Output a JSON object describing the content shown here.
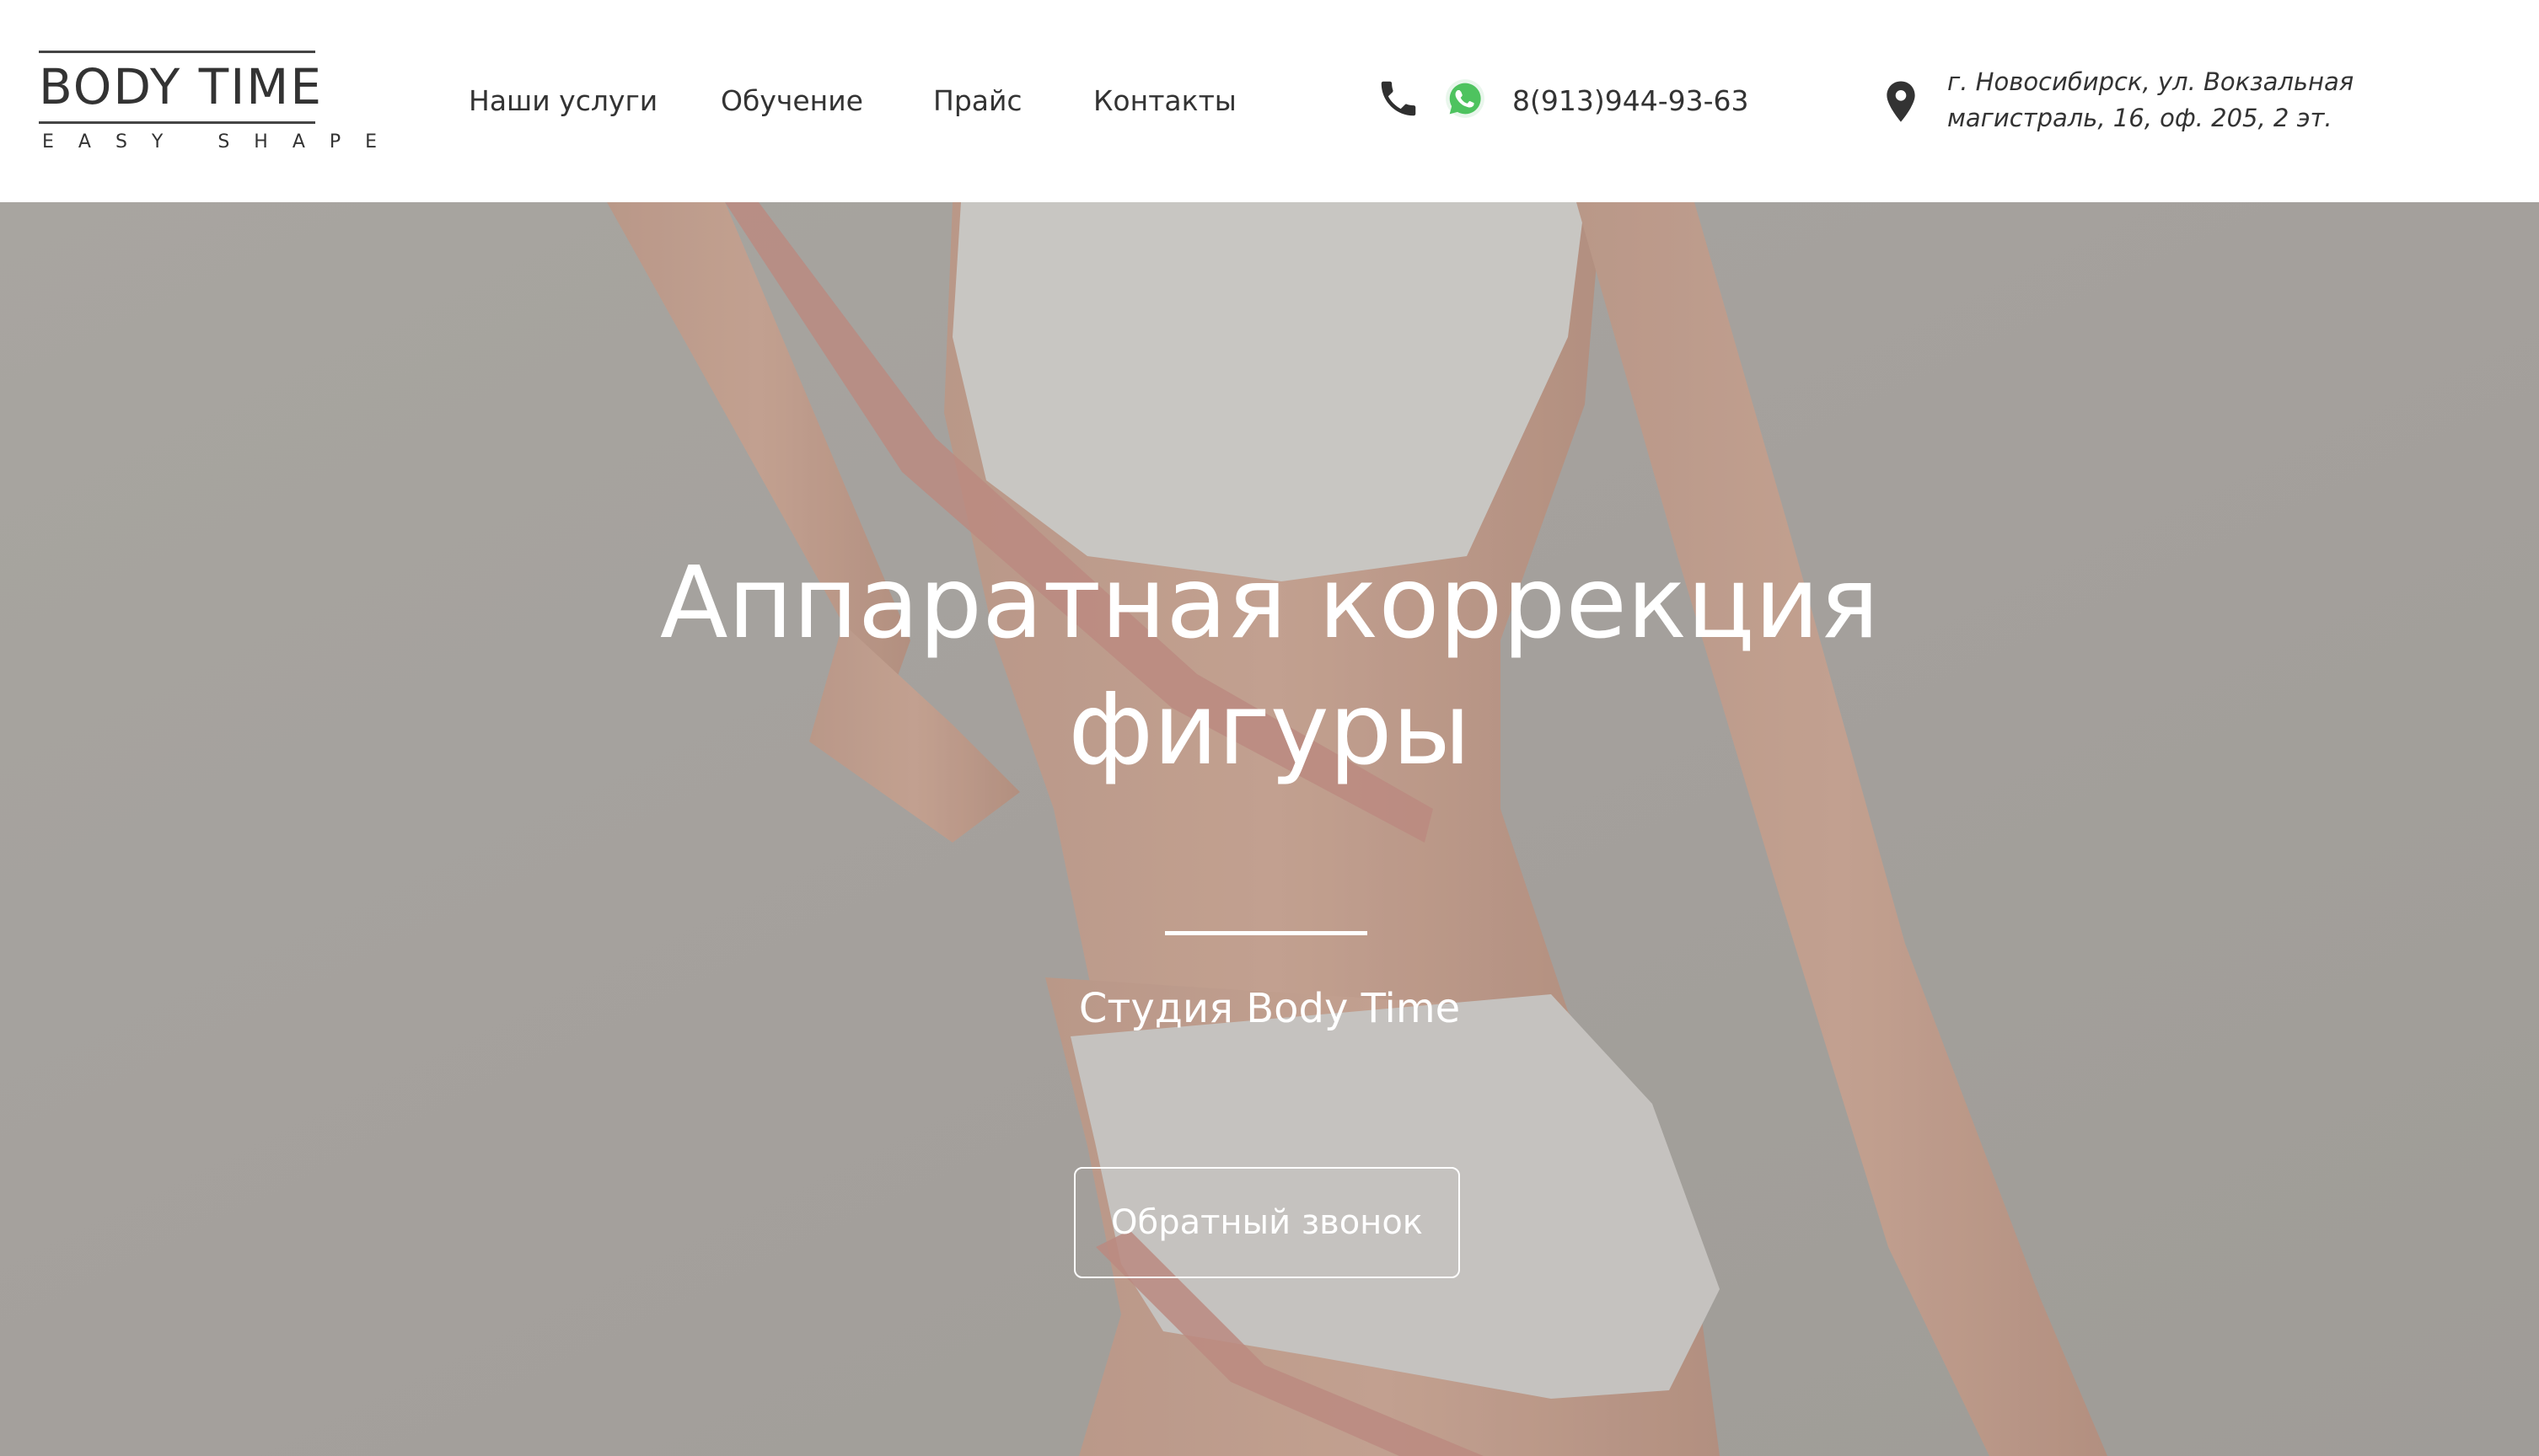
{
  "logo": {
    "title": "BODY TIME",
    "tagline": "EASY SHAPE"
  },
  "nav": {
    "items": [
      {
        "label": "Наши услуги"
      },
      {
        "label": "Обучение"
      },
      {
        "label": "Прайс"
      },
      {
        "label": "Контакты"
      }
    ]
  },
  "contact": {
    "phone_icon": "phone-icon",
    "whatsapp_icon": "whatsapp-icon",
    "phone": "8(913)944-93-63",
    "pin_icon": "map-pin-icon",
    "address_line1": "г. Новосибирск, ул. Вокзальная",
    "address_line2": "магистраль, 16, оф. 205, 2 эт."
  },
  "hero": {
    "title_line1": "Аппаратная коррекция",
    "title_line2": "фигуры",
    "subtitle": "Студия Body Time",
    "button_label": "Обратный звонок"
  },
  "colors": {
    "text": "#333333",
    "header_bg": "#ffffff",
    "hero_overlay": "#aeaaa6",
    "whatsapp": "#4ec35f",
    "hero_text": "#ffffff"
  }
}
